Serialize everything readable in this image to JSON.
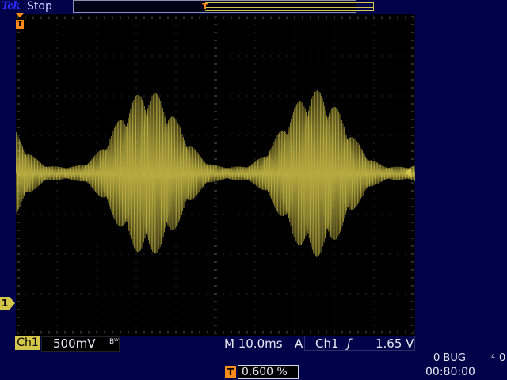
{
  "header": {
    "brand": "Tek",
    "run_state": "Stop",
    "trigger_position_marker": "T"
  },
  "display": {
    "graticule": {
      "h_divisions": 10,
      "v_divisions": 8
    },
    "waveform": {
      "channel": "Ch1",
      "color": "#d3c64a",
      "description": "amplitude-modulated carrier"
    },
    "ch1_ground_marker": "1"
  },
  "status": {
    "ch1_label": "Ch1",
    "ch1_volts_per_div": "500mV",
    "bw_limit": "Bᵂ",
    "timebase": "M 10.0ms",
    "trigger_source_prefix": "A",
    "trigger_source": "Ch1",
    "trigger_slope": "ʃ",
    "trigger_level": "1.65 V",
    "trig_pos_icon": "T",
    "trigger_position": "0.600 %",
    "bug_text": "0 BUG",
    "bug_super": "4",
    "right_zero": "0",
    "clock": "00:80:00"
  },
  "colors": {
    "background": "#00024a",
    "screen": "#000000",
    "channel1": "#d3c64a",
    "trigger": "#ff8b1a",
    "text": "#e8e8f0"
  }
}
